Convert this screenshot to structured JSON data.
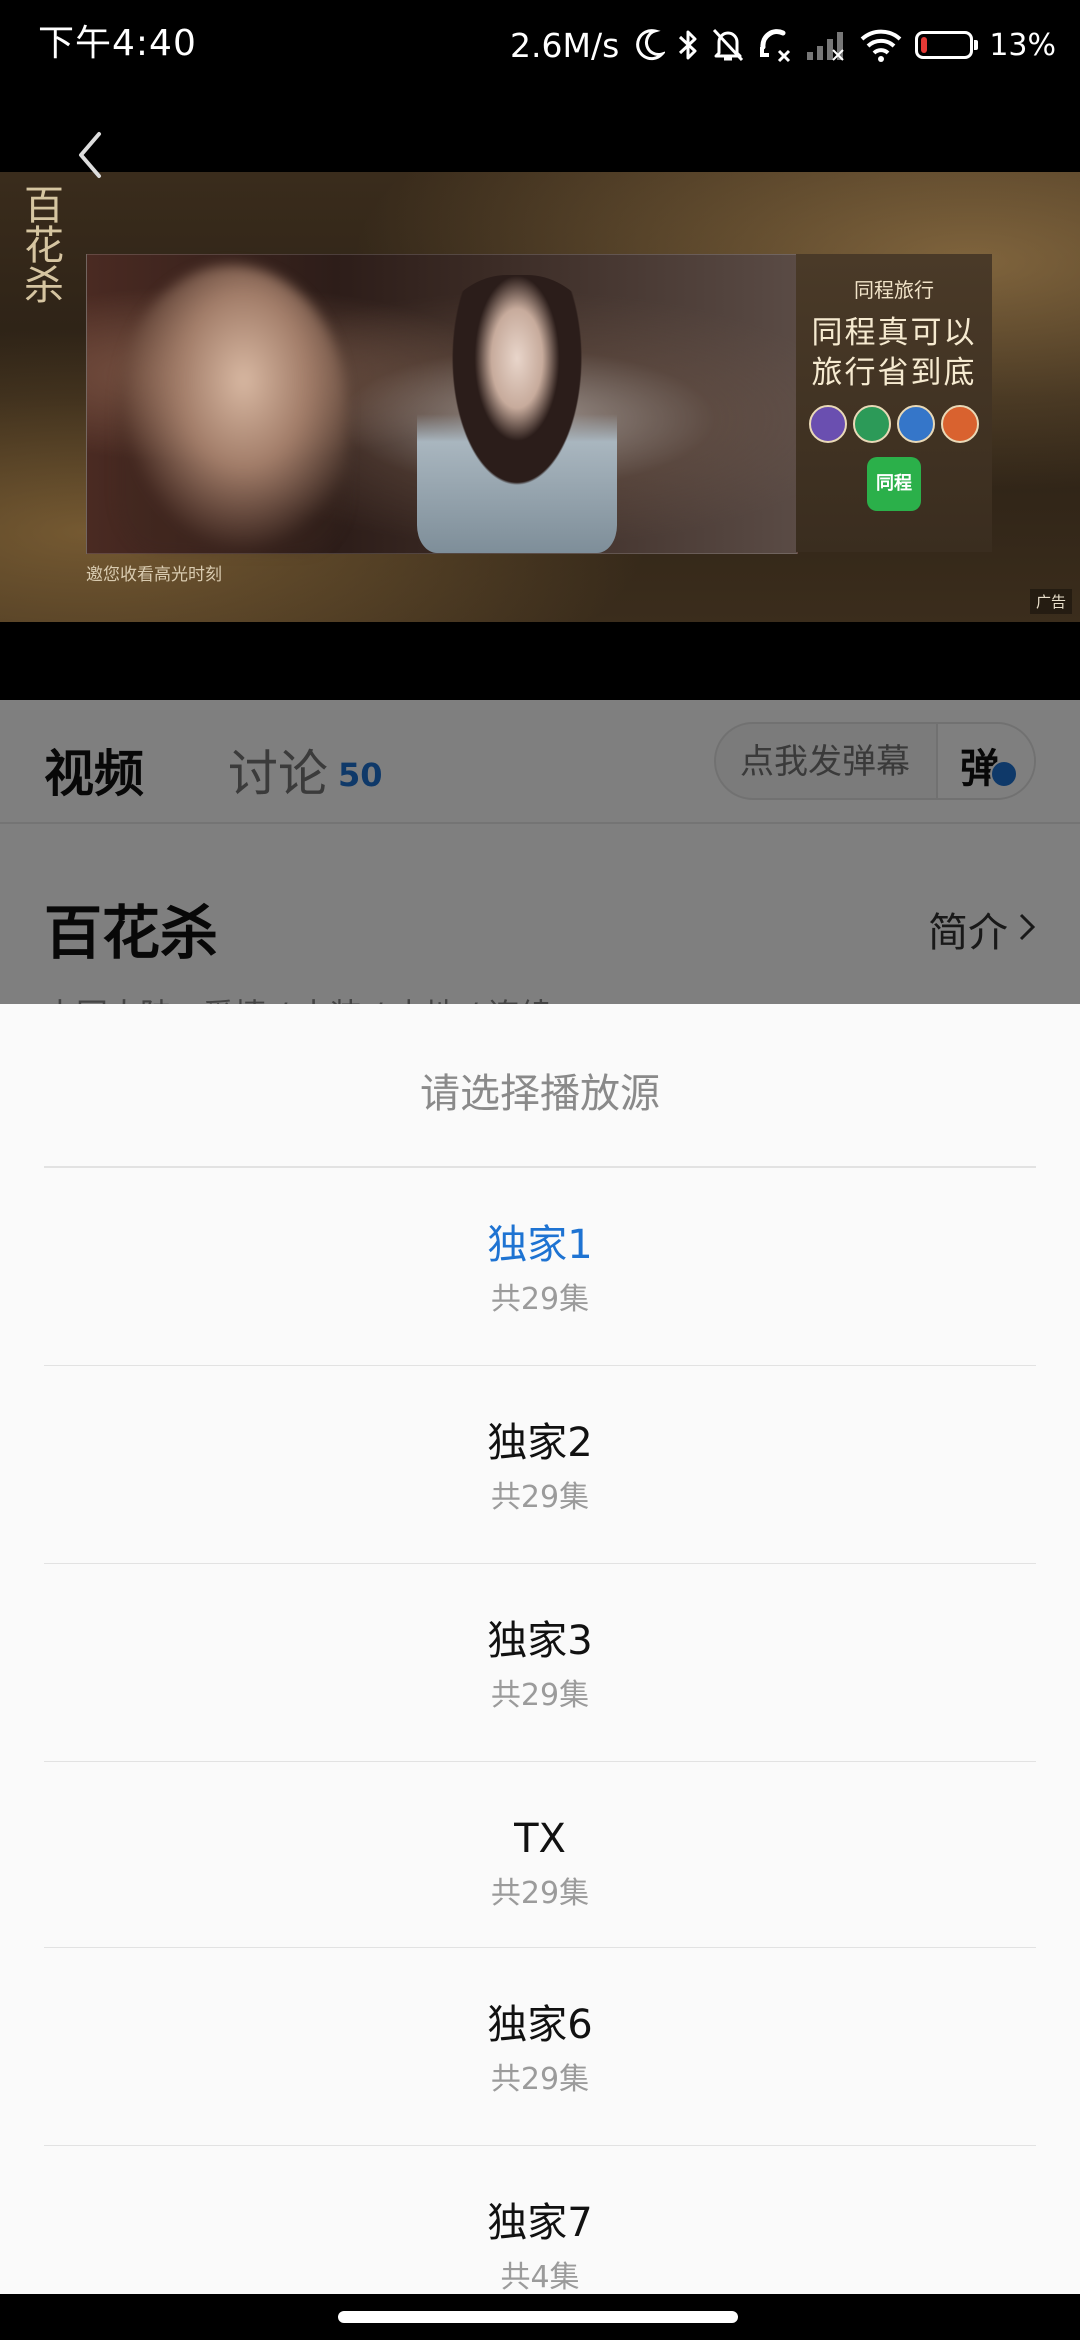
{
  "status_bar": {
    "time": "下午4:40",
    "net_speed": "2.6M/s",
    "battery_level": 0.13,
    "battery_text": "13%",
    "icons": [
      "moon-icon",
      "bluetooth-icon",
      "mute-icon",
      "call-icon",
      "signal-icon",
      "wifi-icon",
      "battery-icon"
    ]
  },
  "player": {
    "ad": {
      "brand": "同程旅行",
      "slogan_line1": "同程真可以",
      "slogan_line2": "旅行省到底",
      "app_logo_text": "同程",
      "show_glyph": "百花杀",
      "caption": "邀您收看高光时刻",
      "ad_label": "广告"
    }
  },
  "tabs": {
    "video": "视频",
    "discussion": "讨论",
    "discussion_count": "50"
  },
  "danmaku": {
    "placeholder": "点我发弹幕",
    "toggle_label": "弹"
  },
  "show": {
    "title": "百花杀",
    "intro_label": "简介",
    "tags": "中国大陆 · 爱情 / 古装 / 内地 / 连续"
  },
  "sheet": {
    "title": "请选择播放源",
    "sources": [
      {
        "name": "独家1",
        "count": "共29集",
        "active": true
      },
      {
        "name": "独家2",
        "count": "共29集",
        "active": false
      },
      {
        "name": "独家3",
        "count": "共29集",
        "active": false
      },
      {
        "name": "TX",
        "count": "共29集",
        "active": false
      },
      {
        "name": "独家6",
        "count": "共29集",
        "active": false
      },
      {
        "name": "独家7",
        "count": "共4集",
        "active": false
      }
    ]
  },
  "colors": {
    "accent": "#1e73d2",
    "battery_low": "#e53935"
  }
}
